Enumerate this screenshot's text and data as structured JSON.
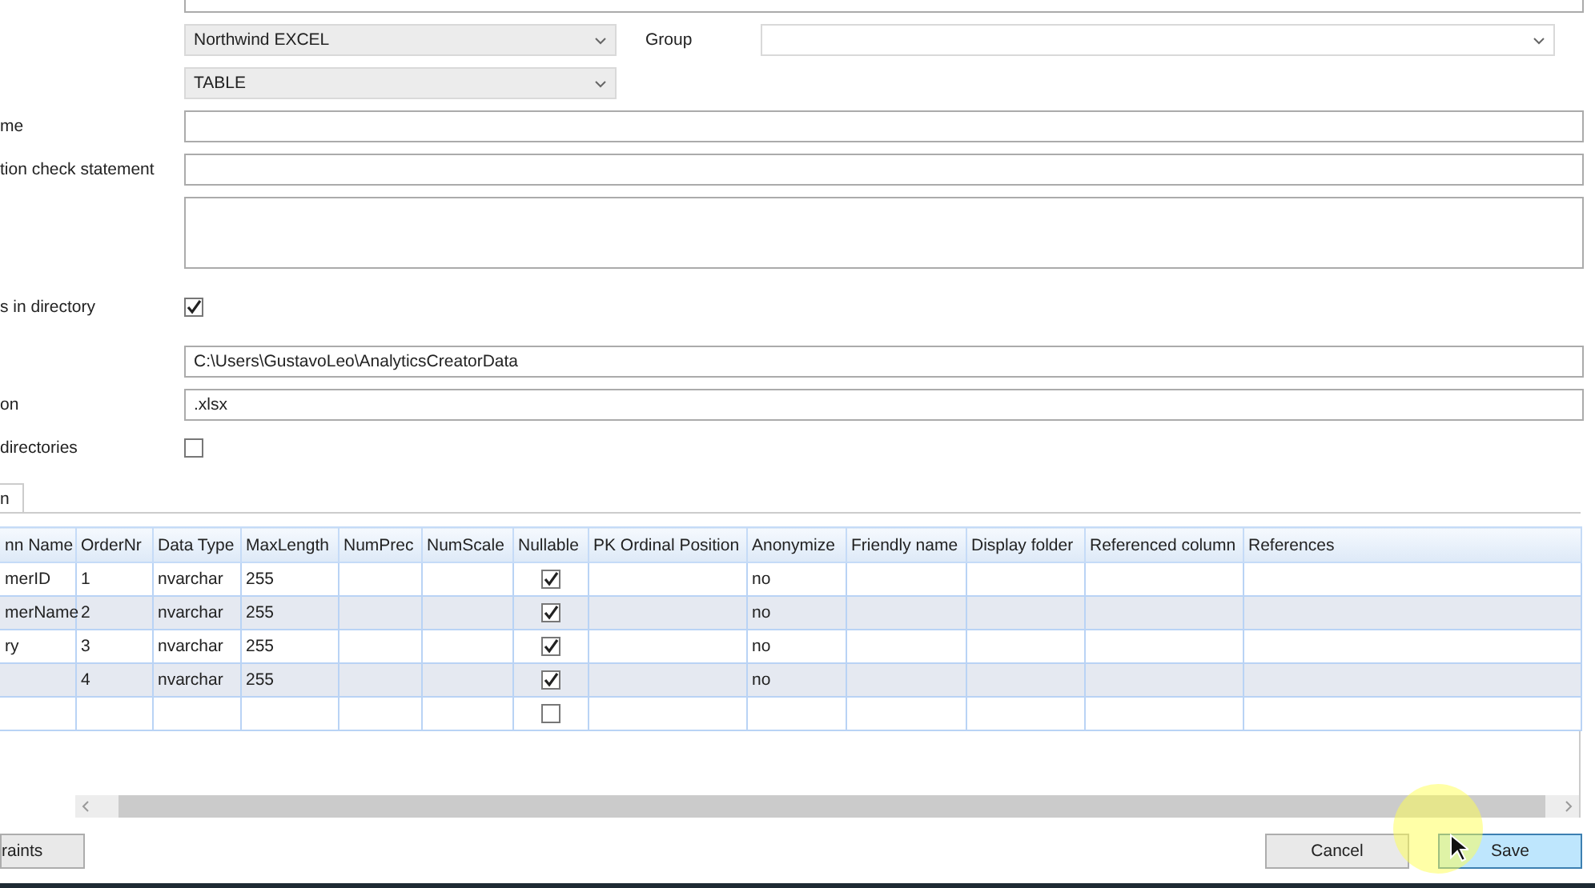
{
  "form": {
    "rows": [
      {
        "kind": "top-field"
      },
      {
        "kind": "select",
        "label": "",
        "value": "Northwind EXCEL",
        "side_label": "Group",
        "side_value": ""
      },
      {
        "kind": "select",
        "label": "",
        "value": "TABLE"
      },
      {
        "kind": "text",
        "label": "me",
        "value": ""
      },
      {
        "kind": "text",
        "label": "tion check statement",
        "value": ""
      },
      {
        "kind": "textarea",
        "label": "",
        "value": ""
      },
      {
        "kind": "checkbox",
        "label": "s in directory",
        "checked": true
      },
      {
        "kind": "text",
        "label": "",
        "value": "C:\\Users\\GustavoLeo\\AnalyticsCreatorData"
      },
      {
        "kind": "text",
        "label": "on",
        "value": ".xlsx"
      },
      {
        "kind": "checkbox",
        "label": "directories",
        "checked": false
      }
    ]
  },
  "tabs": [
    {
      "label": "n",
      "selected": true
    }
  ],
  "table": {
    "columns": [
      "nn Name",
      "OrderNr",
      "Data Type",
      "MaxLength",
      "NumPrec",
      "NumScale",
      "Nullable",
      "PK Ordinal Position",
      "Anonymize",
      "Friendly name",
      "Display folder",
      "Referenced column",
      "References"
    ],
    "rows": [
      {
        "cells": [
          "merID",
          "1",
          "nvarchar",
          "255",
          "",
          "",
          "",
          "",
          "no",
          "",
          "",
          "",
          ""
        ],
        "nullable": true
      },
      {
        "cells": [
          "merName",
          "2",
          "nvarchar",
          "255",
          "",
          "",
          "",
          "",
          "no",
          "",
          "",
          "",
          ""
        ],
        "nullable": true
      },
      {
        "cells": [
          "ry",
          "3",
          "nvarchar",
          "255",
          "",
          "",
          "",
          "",
          "no",
          "",
          "",
          "",
          ""
        ],
        "nullable": true
      },
      {
        "cells": [
          "",
          "4",
          "nvarchar",
          "255",
          "",
          "",
          "",
          "",
          "no",
          "",
          "",
          "",
          ""
        ],
        "nullable": true
      },
      {
        "cells": [
          "",
          "",
          "",
          "",
          "",
          "",
          "",
          "",
          "",
          "",
          "",
          "",
          ""
        ],
        "nullable": false
      }
    ]
  },
  "buttons": [
    {
      "label": "raints",
      "kind": "left"
    },
    {
      "label": "Cancel",
      "kind": "cancel"
    },
    {
      "label": "Save",
      "kind": "primary"
    }
  ]
}
